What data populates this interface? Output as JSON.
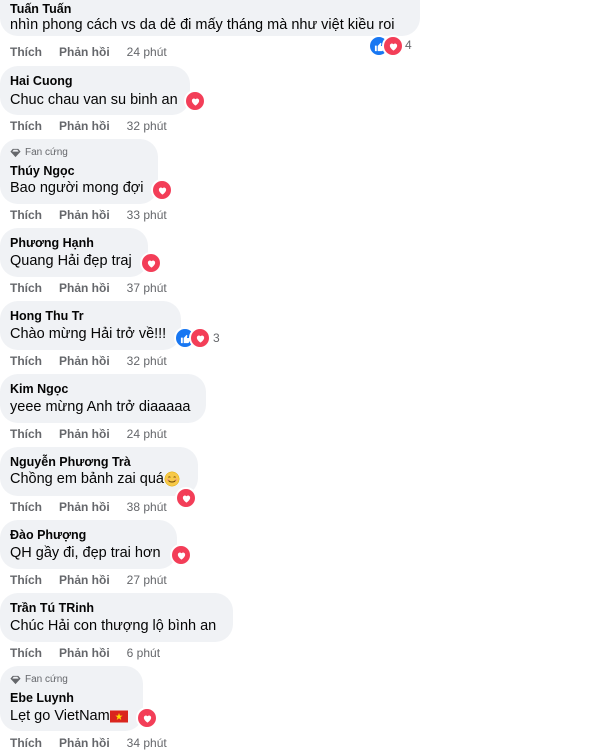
{
  "labels": {
    "like": "Thích",
    "reply": "Phản hồi"
  },
  "comments": [
    {
      "name": "Tuấn Tuấn",
      "text": "nhìn phong cách vs da dẻ đi mấy tháng mà như việt kiều roi",
      "time": "24 phút",
      "reaction_count": "4",
      "reactions": [
        "like",
        "heart"
      ]
    },
    {
      "name": "Hai Cuong",
      "text": "Chuc chau van su binh an",
      "time": "32 phút",
      "reactions": [
        "heart"
      ]
    },
    {
      "badge": "Fan cứng",
      "name": "Thúy Ngọc",
      "text": "Bao người mong đợi",
      "time": "33 phút",
      "reactions": [
        "heart"
      ]
    },
    {
      "name": "Phương Hạnh",
      "text": "Quang Hải đẹp traj",
      "time": "37 phút",
      "reactions": [
        "heart"
      ]
    },
    {
      "name": "Hong Thu Tr",
      "text": "Chào mừng Hải trở về!!!",
      "time": "32 phút",
      "reaction_count": "3",
      "reactions": [
        "like",
        "heart"
      ]
    },
    {
      "name": "Kim Ngọc",
      "text": "yeee mừng Anh trở diaaaaa",
      "time": "24 phút",
      "reactions": []
    },
    {
      "name": "Nguyễn Phương Trà",
      "text": "Chồng em bảnh zai quá",
      "time": "38 phút",
      "reactions": [
        "heart"
      ],
      "emoji": "smiling-face"
    },
    {
      "name": "Đào Phượng",
      "text": "QH gầy đi, đẹp trai hơn",
      "time": "27 phút",
      "reactions": [
        "heart"
      ]
    },
    {
      "name": "Trần Tú TRinh",
      "text": "Chúc Hải con thượng lộ bình an",
      "time": "6 phút",
      "reactions": []
    },
    {
      "badge": "Fan cứng",
      "name": "Ebe Luynh",
      "text": "Lẹt go VietNam",
      "time": "34 phút",
      "reactions": [
        "heart"
      ],
      "emoji": "vietnam-flag"
    }
  ],
  "colors": {
    "bubble": "#f0f2f5",
    "heart": "#f33e58",
    "like": "#1877f2",
    "meta": "#65676b"
  }
}
